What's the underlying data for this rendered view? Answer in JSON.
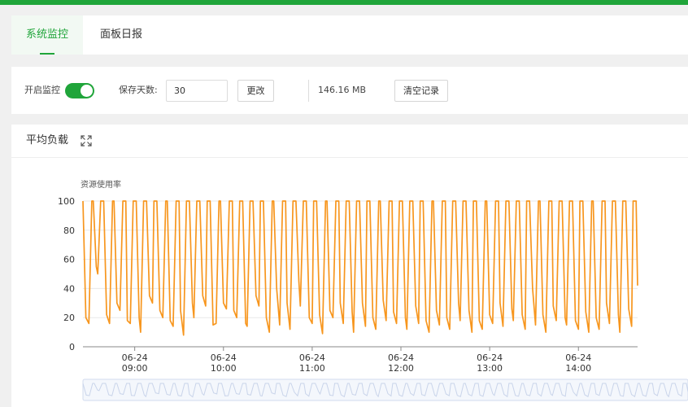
{
  "tabs": [
    {
      "label": "系统监控",
      "active": true
    },
    {
      "label": "面板日报",
      "active": false
    }
  ],
  "controls": {
    "monitor_label": "开启监控",
    "monitor_enabled": true,
    "days_label": "保存天数:",
    "days_value": "30",
    "change_button": "更改",
    "storage_size": "146.16 MB",
    "clear_button": "清空记录"
  },
  "panel": {
    "title": "平均负载",
    "expand_icon": "fullscreen-expand-icon"
  },
  "colors": {
    "accent": "#20a53a",
    "series": "#f7961e",
    "grid": "#e8e8e8",
    "axis_text": "#333333"
  },
  "chart_data": {
    "type": "line",
    "ylabel": "资源使用率",
    "ylim": [
      0,
      100
    ],
    "yticks": [
      0,
      20,
      40,
      60,
      80,
      100
    ],
    "xticks": [
      {
        "date": "06-24",
        "time": "09:00"
      },
      {
        "date": "06-24",
        "time": "10:00"
      },
      {
        "date": "06-24",
        "time": "11:00"
      },
      {
        "date": "06-24",
        "time": "12:00"
      },
      {
        "date": "06-24",
        "time": "13:00"
      },
      {
        "date": "06-24",
        "time": "14:00"
      }
    ],
    "x_start": "06-24 08:25",
    "x_end": "06-24 14:40",
    "series": [
      {
        "time": [
          "08:25",
          "08:27",
          "08:29",
          "08:31",
          "08:32",
          "08:34",
          "08:35",
          "08:37",
          "08:39",
          "08:41",
          "08:43",
          "08:45",
          "08:46",
          "08:48",
          "08:50",
          "08:52",
          "08:54",
          "08:55",
          "08:57",
          "08:59",
          "09:01",
          "09:03",
          "09:04",
          "09:06",
          "09:08",
          "09:10",
          "09:12",
          "09:13",
          "09:15",
          "09:17",
          "09:19",
          "09:21",
          "09:22",
          "09:24",
          "09:26",
          "09:28",
          "09:30",
          "09:31",
          "09:33",
          "09:35",
          "09:37",
          "09:39",
          "09:40",
          "09:42",
          "09:44",
          "09:46",
          "09:48",
          "09:49",
          "09:51",
          "09:53",
          "09:55",
          "09:57",
          "09:58",
          "10:00",
          "10:02",
          "10:04",
          "10:06",
          "10:07",
          "10:09",
          "10:11",
          "10:13",
          "10:15",
          "10:16",
          "10:18",
          "10:20",
          "10:22",
          "10:24",
          "10:25",
          "10:27",
          "10:29",
          "10:31",
          "10:33",
          "10:34",
          "10:36",
          "10:38",
          "10:40",
          "10:42",
          "10:43",
          "10:45",
          "10:47",
          "10:49",
          "10:51",
          "10:52",
          "10:54",
          "10:56",
          "10:58",
          "11:00",
          "11:01",
          "11:03",
          "11:05",
          "11:07",
          "11:09",
          "11:10",
          "11:12",
          "11:14",
          "11:16",
          "11:18",
          "11:19",
          "11:21",
          "11:23",
          "11:25",
          "11:27",
          "11:28",
          "11:30",
          "11:32",
          "11:34",
          "11:36",
          "11:37",
          "11:39",
          "11:41",
          "11:43",
          "11:45",
          "11:46",
          "11:48",
          "11:50",
          "11:52",
          "11:54",
          "11:55",
          "11:57",
          "11:59",
          "12:01",
          "12:03",
          "12:04",
          "12:06",
          "12:08",
          "12:10",
          "12:12",
          "12:13",
          "12:15",
          "12:17",
          "12:19",
          "12:21",
          "12:22",
          "12:24",
          "12:26",
          "12:28",
          "12:30",
          "12:31",
          "12:33",
          "12:35",
          "12:37",
          "12:39",
          "12:40",
          "12:42",
          "12:44",
          "12:46",
          "12:48",
          "12:49",
          "12:51",
          "12:53",
          "12:55",
          "12:57",
          "12:58",
          "13:00",
          "13:02",
          "13:04",
          "13:06",
          "13:07",
          "13:09",
          "13:11",
          "13:13",
          "13:15",
          "13:16",
          "13:18",
          "13:20",
          "13:22",
          "13:24",
          "13:25",
          "13:27",
          "13:29",
          "13:31",
          "13:33",
          "13:34",
          "13:36",
          "13:38",
          "13:40",
          "13:42",
          "13:43",
          "13:45",
          "13:47",
          "13:49",
          "13:51",
          "13:52",
          "13:54",
          "13:56",
          "13:58",
          "14:00",
          "14:01",
          "14:03",
          "14:05",
          "14:07",
          "14:09",
          "14:10",
          "14:12",
          "14:14",
          "14:16",
          "14:18",
          "14:19",
          "14:21",
          "14:23",
          "14:25",
          "14:27",
          "14:28",
          "14:30",
          "14:32",
          "14:34",
          "14:36",
          "14:37",
          "14:39",
          "14:40"
        ],
        "values": [
          100,
          20,
          16,
          100,
          100,
          55,
          50,
          100,
          100,
          22,
          16,
          100,
          100,
          30,
          25,
          100,
          100,
          18,
          16,
          100,
          100,
          20,
          10,
          100,
          100,
          35,
          30,
          100,
          100,
          25,
          20,
          100,
          100,
          18,
          14,
          100,
          100,
          25,
          8,
          100,
          100,
          30,
          20,
          100,
          100,
          35,
          28,
          100,
          100,
          15,
          16,
          100,
          100,
          30,
          26,
          100,
          100,
          25,
          20,
          100,
          100,
          16,
          14,
          100,
          100,
          35,
          28,
          100,
          100,
          20,
          10,
          100,
          100,
          40,
          15,
          100,
          100,
          30,
          12,
          100,
          100,
          45,
          28,
          100,
          100,
          20,
          16,
          100,
          100,
          22,
          9,
          100,
          100,
          25,
          20,
          100,
          100,
          30,
          16,
          100,
          100,
          24,
          10,
          100,
          100,
          30,
          14,
          100,
          100,
          20,
          12,
          100,
          100,
          32,
          18,
          100,
          100,
          24,
          16,
          100,
          100,
          20,
          12,
          100,
          100,
          28,
          16,
          100,
          100,
          18,
          10,
          100,
          100,
          25,
          15,
          100,
          100,
          20,
          12,
          100,
          100,
          30,
          18,
          100,
          100,
          25,
          10,
          100,
          100,
          18,
          12,
          100,
          100,
          22,
          16,
          100,
          100,
          30,
          14,
          100,
          100,
          26,
          18,
          100,
          100,
          22,
          12,
          100,
          100,
          40,
          15,
          100,
          100,
          22,
          10,
          100,
          100,
          28,
          18,
          100,
          100,
          20,
          15,
          100,
          100,
          18,
          12,
          100,
          100,
          24,
          10,
          100,
          100,
          20,
          12,
          100,
          100,
          30,
          16,
          100,
          100,
          22,
          10,
          100,
          100,
          26,
          14,
          100,
          100,
          42,
          18,
          100,
          100,
          18,
          10,
          100,
          100,
          20,
          16,
          100,
          100,
          18,
          10,
          12
        ]
      }
    ]
  }
}
